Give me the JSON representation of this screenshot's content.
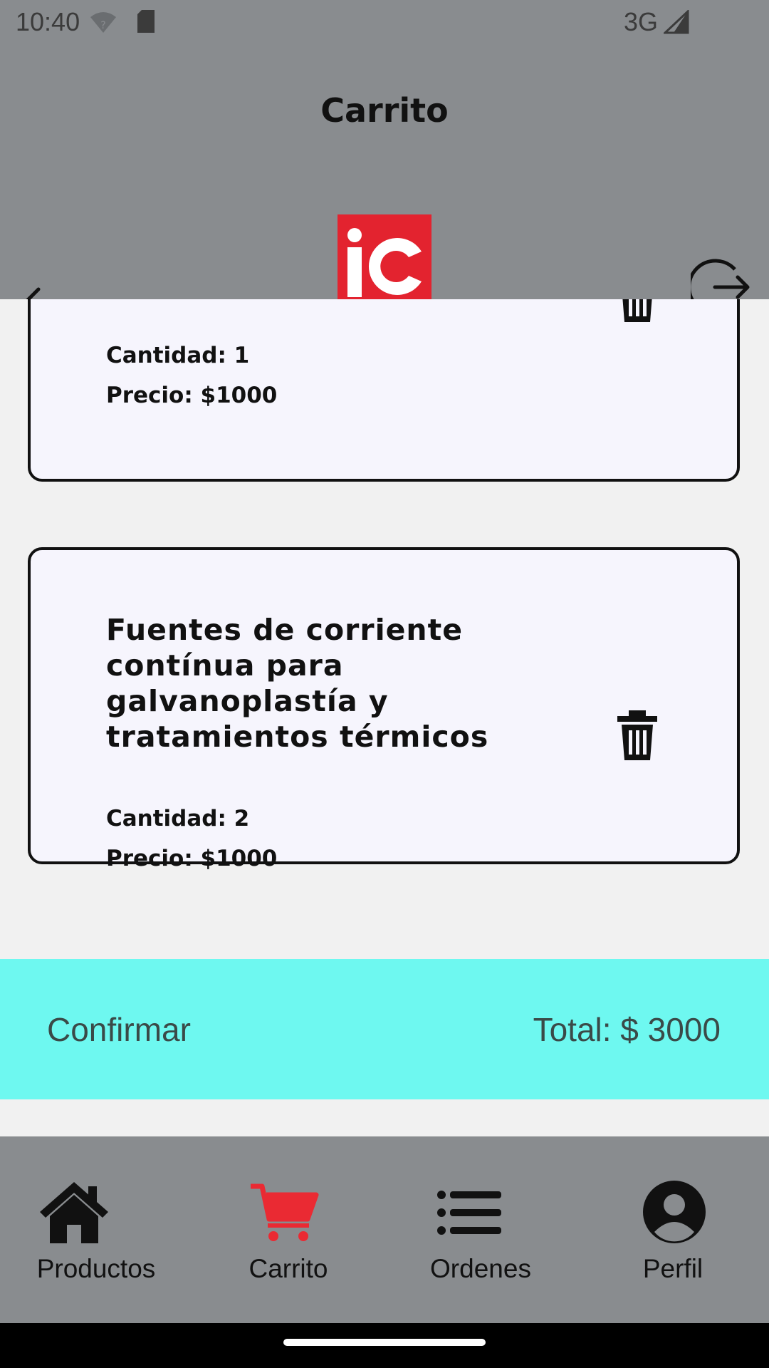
{
  "status_bar": {
    "time": "10:40",
    "network": "3G"
  },
  "header": {
    "title": "Carrito",
    "logo_text": "ic"
  },
  "cart": {
    "items": [
      {
        "name": "",
        "quantity_text": "Cantidad: 1",
        "price_text": "Precio: $1000"
      },
      {
        "name": "Fuentes de corriente contínua para galvanoplastía y tratamientos térmicos",
        "quantity_text": "Cantidad: 2",
        "price_text": "Precio: $1000"
      }
    ]
  },
  "footer": {
    "confirm_label": "Confirmar",
    "total_text": "Total: $ 3000"
  },
  "bottom_nav": {
    "items": [
      {
        "label": "Productos",
        "icon": "home-icon",
        "active": false
      },
      {
        "label": "Carrito",
        "icon": "cart-icon",
        "active": true
      },
      {
        "label": "Ordenes",
        "icon": "list-icon",
        "active": false
      },
      {
        "label": "Perfil",
        "icon": "profile-icon",
        "active": false
      }
    ]
  },
  "colors": {
    "header_bg": "#898c8f",
    "logo_red": "#e3232f",
    "confirm_bg": "#6ef8f0",
    "active_nav": "#ea2a33",
    "card_bg": "#f6f5fd"
  }
}
